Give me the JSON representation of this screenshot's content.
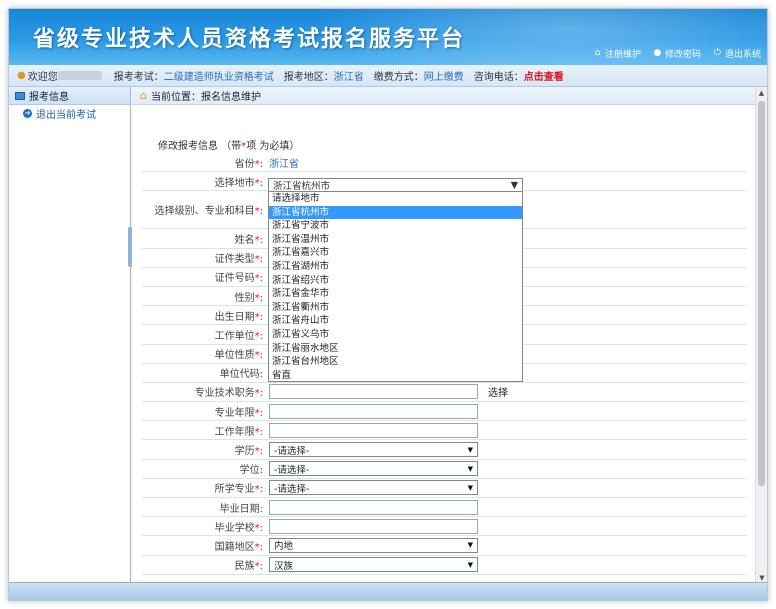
{
  "banner": {
    "title": "省级专业技术人员资格考试报名服务平台",
    "links": [
      {
        "icon": "home-icon",
        "label": "注册维护"
      },
      {
        "icon": "user-icon",
        "label": "修改密码"
      },
      {
        "icon": "power-icon",
        "label": "退出系统"
      }
    ]
  },
  "infobar": {
    "welcome": "欢迎您",
    "exam_key": "报考考试：",
    "exam_val": "二级建造师执业资格考试",
    "region_key": "报考地区：",
    "region_val": "浙江省",
    "pay_key": "缴费方式：",
    "pay_val": "网上缴费",
    "phone_key": "咨询电话：",
    "phone_val": "点击查看"
  },
  "sidebar": {
    "head": "报考信息",
    "items": [
      {
        "label": "退出当前考试"
      }
    ]
  },
  "breadcrumb": {
    "label": "当前位置：报名信息维护"
  },
  "form": {
    "title_a": "修改报考信息 （带",
    "title_star": "*",
    "title_b": "项 为必填）",
    "fields": {
      "province": {
        "label": "省份",
        "value": "浙江省"
      },
      "city": {
        "label": "选择地市",
        "value": "浙江省杭州市"
      },
      "level": {
        "label": "选择级别、专业和科目"
      },
      "name": {
        "label": "姓名"
      },
      "id_type": {
        "label": "证件类型"
      },
      "id_no": {
        "label": "证件号码"
      },
      "gender": {
        "label": "性别"
      },
      "birth": {
        "label": "出生日期"
      },
      "employer": {
        "label": "工作单位"
      },
      "employer_type": {
        "label": "单位性质"
      },
      "employer_code": {
        "label": "单位代码"
      },
      "title": {
        "label": "专业技术职务",
        "action": "选择"
      },
      "prof_years": {
        "label": "专业年限"
      },
      "work_years": {
        "label": "工作年限"
      },
      "education": {
        "label": "学历",
        "value": "-请选择-"
      },
      "degree": {
        "label": "学位",
        "value": "-请选择-"
      },
      "major": {
        "label": "所学专业",
        "value": "-请选择-"
      },
      "grad_date": {
        "label": "毕业日期"
      },
      "school": {
        "label": "毕业学校"
      },
      "nationality": {
        "label": "国籍地区",
        "value": "内地"
      },
      "ethnicity": {
        "label": "民族",
        "value": "汉族"
      }
    }
  },
  "city_options": [
    "请选择地市",
    "浙江省杭州市",
    "浙江省宁波市",
    "浙江省温州市",
    "浙江省嘉兴市",
    "浙江省湖州市",
    "浙江省绍兴市",
    "浙江省金华市",
    "浙江省衢州市",
    "浙江省舟山市",
    "浙江省义乌市",
    "浙江省丽水地区",
    "浙江省台州地区",
    "省直"
  ],
  "city_selected_index": 1,
  "colors": {
    "accent": "#1a86d6",
    "required": "#e0121a",
    "link": "#2a6cbd",
    "highlight": "#3399ff"
  }
}
